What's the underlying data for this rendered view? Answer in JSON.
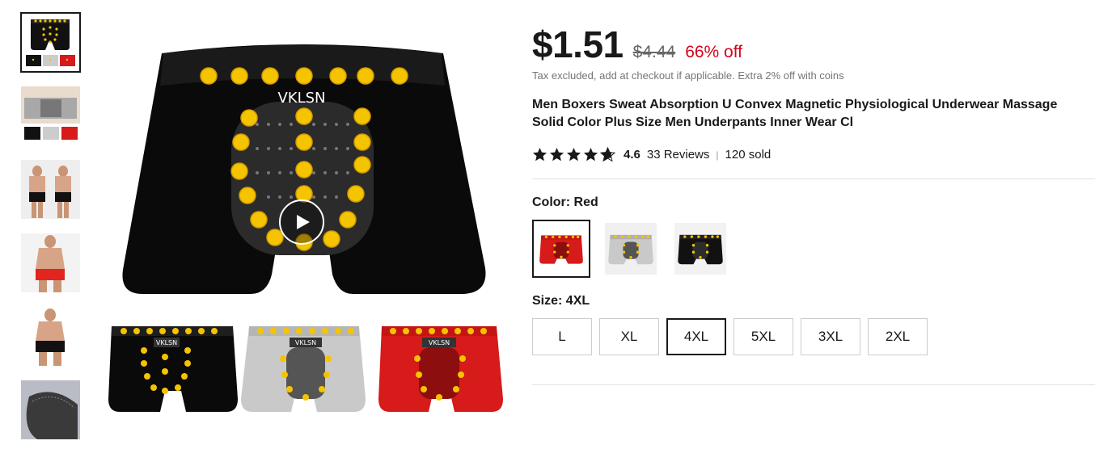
{
  "gallery": {
    "thumbnails": [
      {
        "name": "thumb-product-colors",
        "active": true
      },
      {
        "name": "thumb-model-gray"
      },
      {
        "name": "thumb-models-pair"
      },
      {
        "name": "thumb-model-red"
      },
      {
        "name": "thumb-model-black"
      },
      {
        "name": "thumb-fabric-closeup"
      }
    ],
    "main_logo": "VKLSN",
    "variant_logo": "VKLSN"
  },
  "product": {
    "price": "$1.51",
    "original_price": "$4.44",
    "discount": "66% off",
    "tax_note": "Tax excluded, add at checkout if applicable. Extra 2% off with coins",
    "title": "Men Boxers Sweat Absorption U Convex Magnetic Physiological Underwear Massage Solid Color Plus Size Men Underpants Inner Wear Cl",
    "rating": "4.6",
    "reviews": "33 Reviews",
    "separator": "|",
    "sold": "120 sold",
    "stars": 4.6
  },
  "color": {
    "label": "Color: ",
    "selected": "Red",
    "options": [
      {
        "name": "red",
        "hex": "#d71a1a"
      },
      {
        "name": "gray",
        "hex": "#c9c9c9"
      },
      {
        "name": "black",
        "hex": "#111111"
      }
    ]
  },
  "size": {
    "label": "Size: ",
    "selected": "4XL",
    "options": [
      "L",
      "XL",
      "4XL",
      "5XL",
      "3XL",
      "2XL"
    ]
  },
  "colors": {
    "discount_red": "#d3031c",
    "dot_yellow": "#f5c400",
    "text_dark": "#191919"
  }
}
